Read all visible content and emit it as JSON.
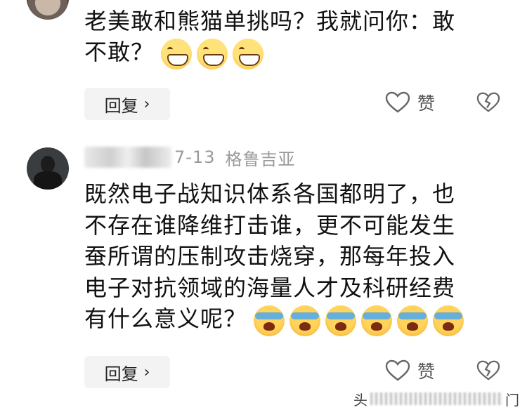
{
  "comments": [
    {
      "text_line1": "老美敢和熊猫单挑吗？我就问你：敢",
      "text_line2": "不敢？",
      "emojis": [
        "grin-emoji",
        "grin-emoji",
        "grin-emoji"
      ],
      "reply_label": "回复",
      "reply_chevron": "›",
      "like_label": "赞"
    },
    {
      "date": "7-13",
      "location": "格鲁吉亚",
      "lines": [
        "既然电子战知识体系各国都明了，也",
        "不存在谁降维打击谁，更不可能发生",
        "蚕所谓的压制攻击烧穿，那每年投入",
        "电子对抗领域的海量人才及科研经费",
        "有什么意义呢？"
      ],
      "emojis": [
        "crying-laugh-emoji",
        "crying-laugh-emoji",
        "crying-laugh-emoji",
        "crying-laugh-emoji",
        "crying-laugh-emoji",
        "crying-laugh-emoji"
      ],
      "reply_label": "回复",
      "reply_chevron": "›",
      "like_label": "赞"
    }
  ],
  "watermark": {
    "left": "头",
    "right": "门"
  },
  "colors": {
    "text": "#111111",
    "meta": "#9a9a9a",
    "reply_bg": "#f3f3f3",
    "icon": "#555555"
  }
}
